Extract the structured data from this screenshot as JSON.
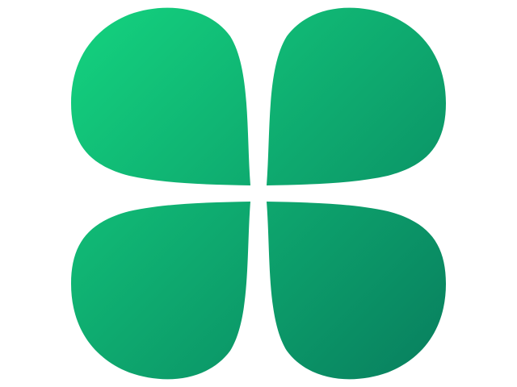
{
  "logo": {
    "icon": "four-leaf-clover-icon",
    "colors": {
      "gradient_start": "#14D37F",
      "gradient_end": "#087E5E",
      "background": "#FFFFFF"
    }
  }
}
